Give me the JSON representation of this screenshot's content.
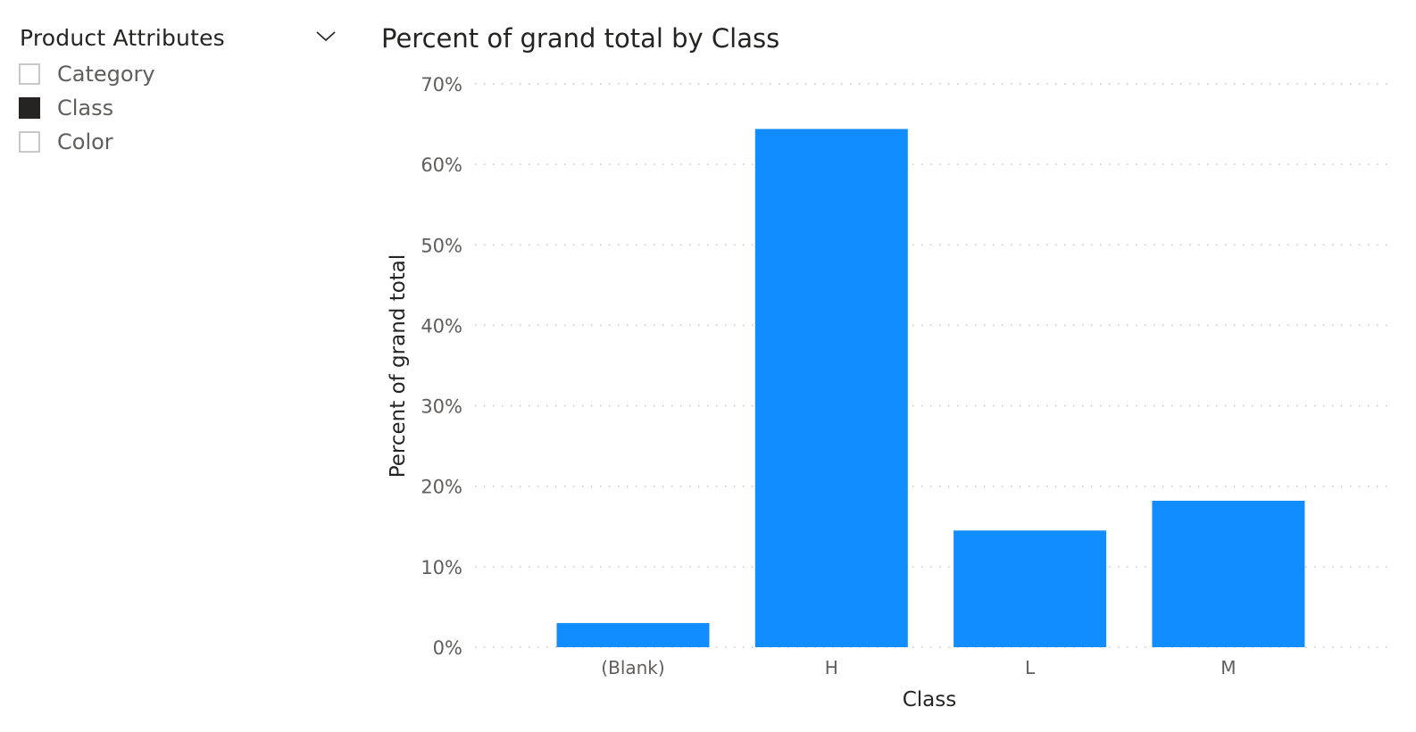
{
  "slicer": {
    "title": "Product Attributes",
    "expand_icon": "chevron-down-icon",
    "items": [
      {
        "label": "Category",
        "checked": false
      },
      {
        "label": "Class",
        "checked": true
      },
      {
        "label": "Color",
        "checked": false
      }
    ]
  },
  "colors": {
    "bar": "#118DFF",
    "text_dark": "#252423",
    "text_muted": "#605E5C",
    "gridline": "#C8C6C4"
  },
  "chart_data": {
    "type": "bar",
    "title": "Percent of grand total by Class",
    "xlabel": "Class",
    "ylabel": "Percent of grand total",
    "categories": [
      "(Blank)",
      "H",
      "L",
      "M"
    ],
    "values": [
      3.0,
      64.4,
      14.5,
      18.2
    ],
    "value_unit": "%",
    "ylim": [
      0,
      70
    ],
    "yticks": [
      0,
      10,
      20,
      30,
      40,
      50,
      60,
      70
    ],
    "ytick_labels": [
      "0%",
      "10%",
      "20%",
      "30%",
      "40%",
      "50%",
      "60%",
      "70%"
    ],
    "grid": true,
    "legend": "none"
  }
}
